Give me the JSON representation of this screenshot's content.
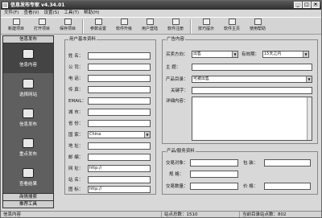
{
  "window": {
    "title": "信息发布专家 v4.34.01"
  },
  "menu": [
    "文件(F)",
    "查看(V)",
    "设置(S)",
    "工具(T)",
    "帮助(H)"
  ],
  "toolbar": [
    {
      "label": "新建项目",
      "icon": "new-project-icon"
    },
    {
      "label": "打开项目",
      "icon": "open-project-icon"
    },
    {
      "label": "保存项目",
      "icon": "save-project-icon"
    },
    {
      "label": "参数设置",
      "icon": "settings-icon"
    },
    {
      "label": "软件升级",
      "icon": "upgrade-icon"
    },
    {
      "label": "用户登陆",
      "icon": "login-icon"
    },
    {
      "label": "软件注册",
      "icon": "register-icon"
    },
    {
      "label": "技巧提示",
      "icon": "tips-icon"
    },
    {
      "label": "软件主页",
      "icon": "home-icon"
    },
    {
      "label": "使用帮助",
      "icon": "help-icon"
    }
  ],
  "sidebar": {
    "header": "信息发布",
    "items": [
      {
        "label": "信息内容",
        "icon": "content-icon"
      },
      {
        "label": "选择网站",
        "icon": "select-site-icon"
      },
      {
        "label": "信息发布",
        "icon": "publish-icon"
      },
      {
        "label": "重点发布",
        "icon": "priority-publish-icon"
      },
      {
        "label": "查看结果",
        "icon": "view-results-icon"
      }
    ],
    "footer": [
      "商情搜索",
      "推荐工具"
    ]
  },
  "user_info": {
    "title": "用户基本资料",
    "fields": [
      {
        "label": "姓  名：",
        "value": ""
      },
      {
        "label": "公  司：",
        "value": ""
      },
      {
        "label": "电  话：",
        "value": ""
      },
      {
        "label": "传  真：",
        "value": ""
      },
      {
        "label": "EMAIL：",
        "value": ""
      },
      {
        "label": "城  市：",
        "value": ""
      },
      {
        "label": "省  份：",
        "value": ""
      },
      {
        "label": "国  家：",
        "value": "China"
      },
      {
        "label": "地  址：",
        "value": ""
      },
      {
        "label": "邮  编：",
        "value": ""
      },
      {
        "label": "网  址：",
        "value": "http://"
      },
      {
        "label": "站  名：",
        "value": ""
      },
      {
        "label": "图  标：",
        "value": "http://"
      }
    ]
  },
  "ad_content": {
    "title": "广告内容",
    "type_label": "买卖方向：",
    "type_value": "出售",
    "valid_label": "有效期：",
    "valid_value": "15天之内",
    "subject_label": "主  题：",
    "subject_value": "",
    "category_label": "产品目录：",
    "category_value": "可被出售",
    "keyword_label": "关键字：",
    "keyword_value": "",
    "detail_label": "详细内容："
  },
  "product": {
    "title": "产品/服务资料",
    "price_label": "交易对象：",
    "price_value": "",
    "pack_label": "包  装：",
    "pack_value": "",
    "spec_label": "规  格：",
    "spec_value": "",
    "qty_label": "交易数量：",
    "qty_value": "",
    "unit_label": "价  格：",
    "unit_value": ""
  },
  "status": {
    "left": "信息内容",
    "total_sites": "站点总数：1510",
    "current_sites": "当前目录站点数：802"
  }
}
